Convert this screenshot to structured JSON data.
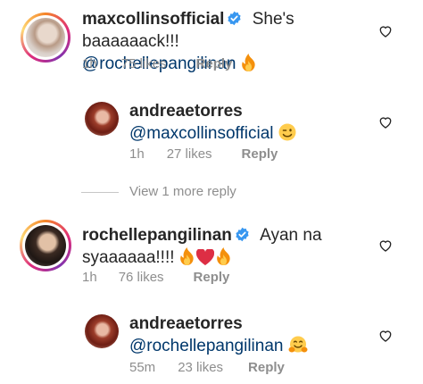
{
  "comments": [
    {
      "username": "maxcollinsofficial",
      "verified": true,
      "text": "She's baaaaaack!!!",
      "mention": "@rochellepangilinan",
      "emoji": "fire-emoji",
      "time": "1h",
      "likes": "75 likes",
      "reply": "Reply"
    },
    {
      "username": "andreaetorres",
      "verified": false,
      "mention": "@maxcollinsofficial",
      "emoji": "winking-face-emoji",
      "time": "1h",
      "likes": "27 likes",
      "reply": "Reply"
    },
    {
      "username": "rochellepangilinan",
      "verified": true,
      "text_line1": "Ayan na",
      "text_line2": "syaaaaaa!!!!",
      "emojis": [
        "fire-emoji",
        "red-heart-emoji",
        "fire-emoji"
      ],
      "time": "1h",
      "likes": "76 likes",
      "reply": "Reply"
    },
    {
      "username": "andreaetorres",
      "verified": false,
      "mention": "@rochellepangilinan",
      "emoji": "hugging-face-emoji",
      "time": "55m",
      "likes": "23 likes",
      "reply": "Reply"
    }
  ],
  "view_more": "View 1 more reply",
  "colors": {
    "text": "#262626",
    "secondary": "#8e8e8e",
    "mention": "#00376b",
    "verified": "#3897f0"
  }
}
